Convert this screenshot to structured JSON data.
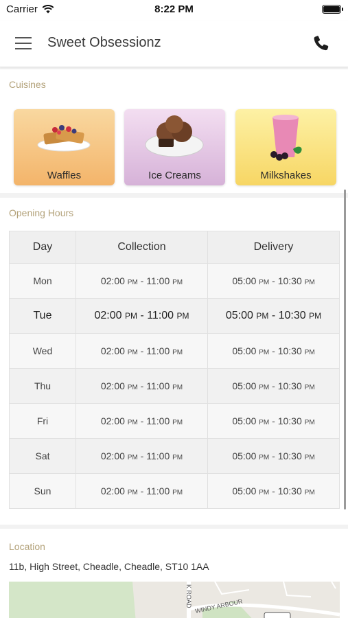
{
  "status_bar": {
    "carrier": "Carrier",
    "time": "8:22 PM"
  },
  "header": {
    "title": "Sweet Obsessionz",
    "menu_icon": "hamburger-menu-icon",
    "phone_icon": "phone-icon"
  },
  "cuisines": {
    "title": "Cuisines",
    "items": [
      {
        "label": "Waffles",
        "color": "#f3b46a"
      },
      {
        "label": "Ice Creams",
        "color": "#d6b2d8"
      },
      {
        "label": "Milkshakes",
        "color": "#f7d664"
      }
    ]
  },
  "opening_hours": {
    "title": "Opening Hours",
    "columns": [
      "Day",
      "Collection",
      "Delivery"
    ],
    "rows": [
      {
        "day": "Mon",
        "col_from": "02:00",
        "col_from_ap": "PM",
        "col_to": "11:00",
        "col_to_ap": "PM",
        "del_from": "05:00",
        "del_from_ap": "PM",
        "del_to": "10:30",
        "del_to_ap": "PM"
      },
      {
        "day": "Tue",
        "col_from": "02:00",
        "col_from_ap": "PM",
        "col_to": "11:00",
        "col_to_ap": "PM",
        "del_from": "05:00",
        "del_from_ap": "PM",
        "del_to": "10:30",
        "del_to_ap": "PM"
      },
      {
        "day": "Wed",
        "col_from": "02:00",
        "col_from_ap": "PM",
        "col_to": "11:00",
        "col_to_ap": "PM",
        "del_from": "05:00",
        "del_from_ap": "PM",
        "del_to": "10:30",
        "del_to_ap": "PM"
      },
      {
        "day": "Thu",
        "col_from": "02:00",
        "col_from_ap": "PM",
        "col_to": "11:00",
        "col_to_ap": "PM",
        "del_from": "05:00",
        "del_from_ap": "PM",
        "del_to": "10:30",
        "del_to_ap": "PM"
      },
      {
        "day": "Fri",
        "col_from": "02:00",
        "col_from_ap": "PM",
        "col_to": "11:00",
        "col_to_ap": "PM",
        "del_from": "05:00",
        "del_from_ap": "PM",
        "del_to": "10:30",
        "del_to_ap": "PM"
      },
      {
        "day": "Sat",
        "col_from": "02:00",
        "col_from_ap": "PM",
        "col_to": "11:00",
        "col_to_ap": "PM",
        "del_from": "05:00",
        "del_from_ap": "PM",
        "del_to": "10:30",
        "del_to_ap": "PM"
      },
      {
        "day": "Sun",
        "col_from": "02:00",
        "col_from_ap": "PM",
        "col_to": "11:00",
        "col_to_ap": "PM",
        "del_from": "05:00",
        "del_from_ap": "PM",
        "del_to": "10:30",
        "del_to_ap": "PM"
      }
    ]
  },
  "location": {
    "title": "Location",
    "address": "11b, High Street, Cheadle, Cheadle, ST10 1AA",
    "map_labels": [
      "K ROAD",
      "WINDY ARBOUR"
    ]
  }
}
